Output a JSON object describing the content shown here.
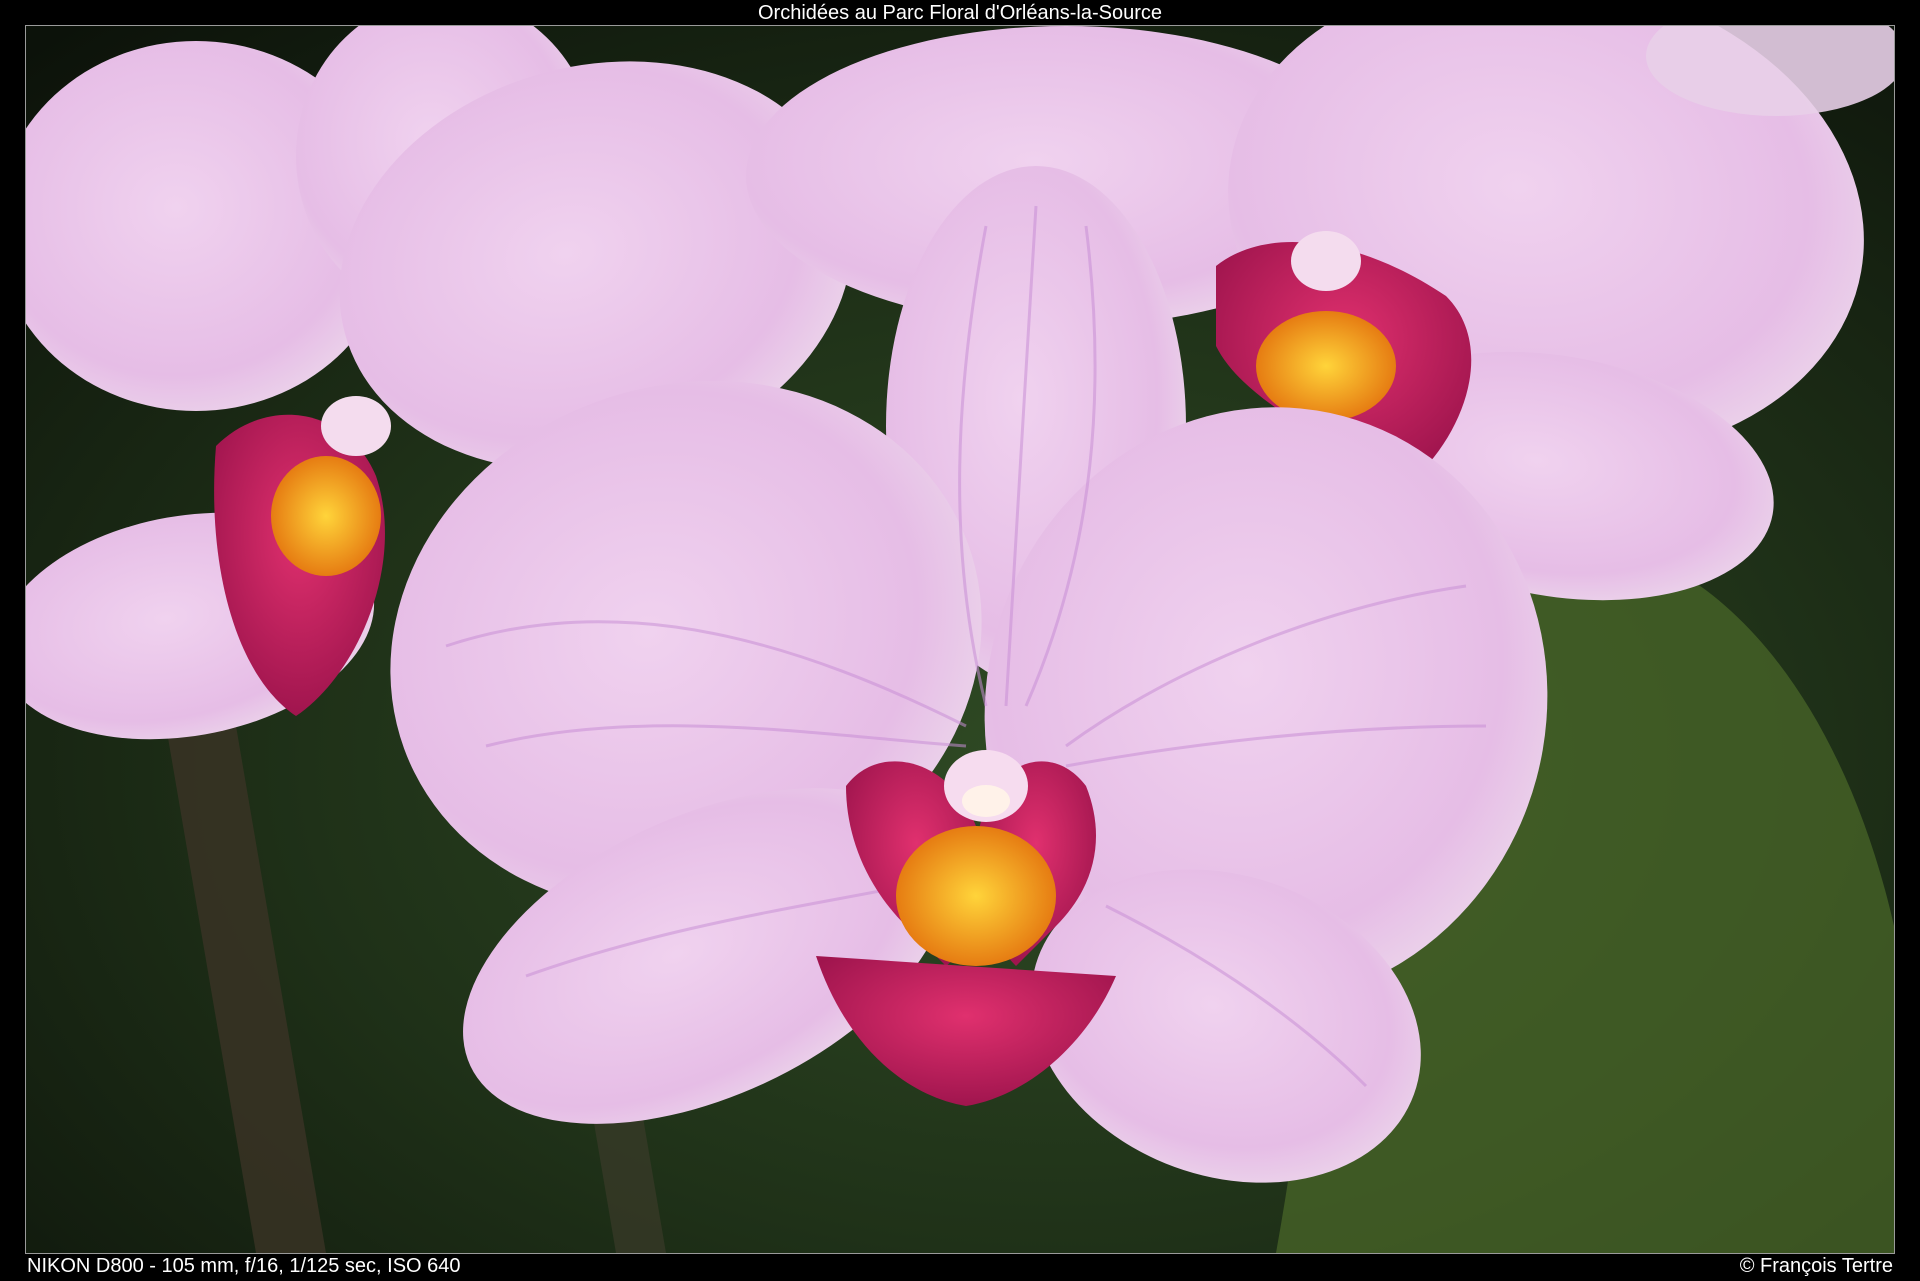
{
  "title": "Orchidées au Parc Floral d'Orléans-la-Source",
  "exif": "NIKON D800 - 105 mm, f/16, 1/125 sec, ISO 640",
  "copyright": "© François Tertre",
  "photo": {
    "subject": "orchid-flowers",
    "colors": {
      "petal": "#e8c6e8",
      "petal_vein": "#c98fd6",
      "lip": "#c4205f",
      "center": "#f3a21b",
      "background": "#1d2a17"
    }
  }
}
